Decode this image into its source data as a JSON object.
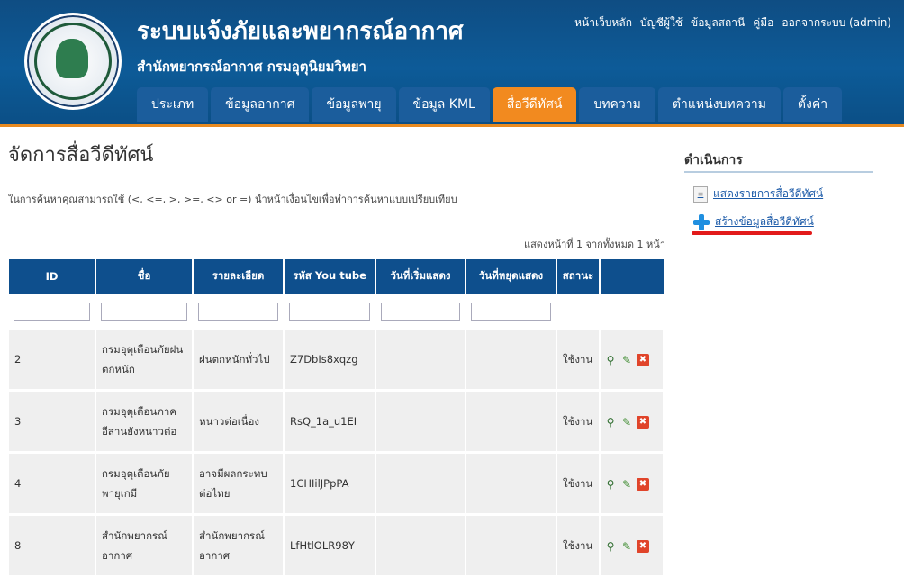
{
  "header": {
    "title": "ระบบแจ้งภัยและพยากรณ์อากาศ",
    "subtitle": "สำนักพยากรณ์อากาศ กรมอุตุนิยมวิทยา",
    "logo_icon": "meteorological-department-seal"
  },
  "toplinks": [
    "หน้าเว็บหลัก",
    "บัญชีผู้ใช้",
    "ข้อมูลสถานี",
    "คู่มือ",
    "ออกจากระบบ (admin)"
  ],
  "nav": {
    "active_index": 4,
    "tabs": [
      "ประเภท",
      "ข้อมูลอากาศ",
      "ข้อมูลพายุ",
      "ข้อมูล KML",
      "สื่อวีดีทัศน์",
      "บทความ",
      "ตำแหน่งบทความ",
      "ตั้งค่า"
    ]
  },
  "main": {
    "page_title": "จัดการสื่อวีดีทัศน์",
    "search_hint": "ในการค้นหาคุณสามารถใช้ (<, <=, >, >=, <> or =) นำหน้าเงื่อนไขเพื่อทำการค้นหาแบบเปรียบเทียบ",
    "pager": "แสดงหน้าที่ 1 จากทั้งหมด 1 หน้า"
  },
  "table": {
    "columns": [
      "ID",
      "ชื่อ",
      "รายละเอียด",
      "รหัส You tube",
      "วันที่เริ่มแสดง",
      "วันที่หยุดแสดง",
      "สถานะ",
      ""
    ],
    "rows": [
      {
        "id": "2",
        "name": "กรมอุตุเตือนภัยฝนตกหนัก",
        "detail": "ฝนตกหนักทั่วไป",
        "youtube": "Z7DbIs8xqzg",
        "start": "",
        "end": "",
        "status": "ใช้งาน"
      },
      {
        "id": "3",
        "name": "กรมอุตุเตือนภาคอีสานยังหนาวต่อ",
        "detail": "หนาวต่อเนื่อง",
        "youtube": "RsQ_1a_u1EI",
        "start": "",
        "end": "",
        "status": "ใช้งาน"
      },
      {
        "id": "4",
        "name": "กรมอุตุเตือนภัยพายุเกมี",
        "detail": "อาจมีผลกระทบต่อไทย",
        "youtube": "1CHIilJPpPA",
        "start": "",
        "end": "",
        "status": "ใช้งาน"
      },
      {
        "id": "8",
        "name": "สำนักพยากรณ์อากาศ",
        "detail": "สำนักพยากรณ์อากาศ",
        "youtube": "LfHtlOLR98Y",
        "start": "",
        "end": "",
        "status": "ใช้งาน"
      }
    ]
  },
  "sidebar": {
    "title": "ดำเนินการ",
    "list_label": "แสดงรายการสื่อวีดีทัศน์",
    "create_label": "สร้างข้อมูลสื่อวีดีทัศน์"
  },
  "colors": {
    "header_blue": "#0d5b98",
    "tab_active": "#f28a1f",
    "table_header": "#0e4f8d",
    "link": "#1b5aa8",
    "highlight_red": "#e21a1a"
  }
}
